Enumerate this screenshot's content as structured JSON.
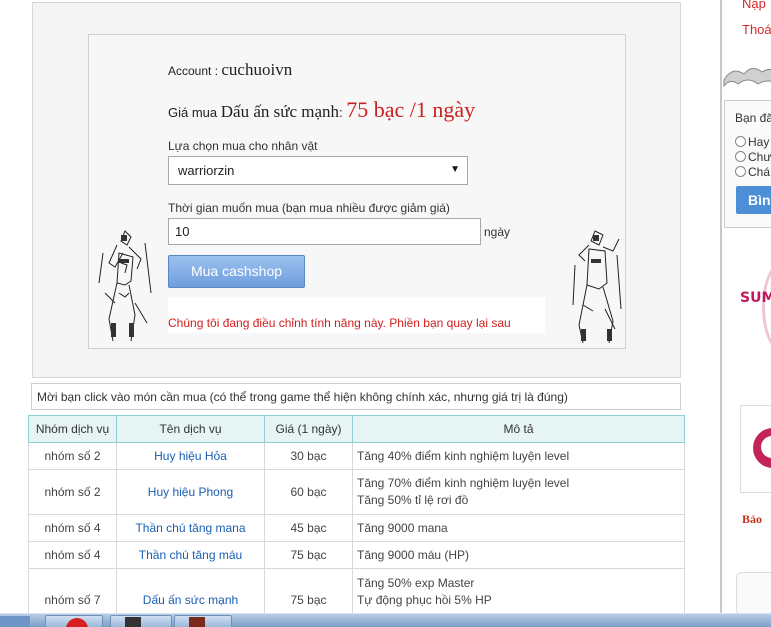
{
  "purchase": {
    "account_label": "Account : ",
    "account_value": "cuchuoivn",
    "price_label": "Giá mua ",
    "item_name": "Dấu ấn sức mạnh",
    "price_colon": ": ",
    "price_text": "75 bạc /1 ngày",
    "character_label": "Lựa chọn mua cho nhân vật",
    "character_selected": "warriorzin",
    "duration_label": "Thời gian muốn mua (bạn mua nhiều được giảm giá)",
    "duration_value": "10",
    "duration_unit": "ngày",
    "buy_button": "Mua cashshop",
    "notice": "Chúng tôi đang điều chỉnh tính năng này. Phiền bạn quay lại sau"
  },
  "hint": "Mời bạn click vào món cần mua (có thể trong game thể hiện không chính xác, nhưng giá trị là đúng)",
  "table": {
    "headers": [
      "Nhóm dịch vụ",
      "Tên dịch vụ",
      "Giá (1 ngày)",
      "Mô tả"
    ],
    "rows": [
      {
        "group": "nhóm số 2",
        "name": "Huy hiệu Hỏa",
        "price": "30 bạc",
        "desc": [
          "Tăng 40% điểm kinh nghiệm luyện level"
        ]
      },
      {
        "group": "nhóm số 2",
        "name": "Huy hiệu Phong",
        "price": "60 bạc",
        "desc": [
          "Tăng 70% điểm kinh nghiệm luyện level",
          "Tăng 50% tỉ lệ rơi đồ"
        ]
      },
      {
        "group": "nhóm số 4",
        "name": "Thần chú tăng mana",
        "price": "45 bạc",
        "desc": [
          "Tăng 9000 mana"
        ]
      },
      {
        "group": "nhóm số 4",
        "name": "Thần chú tăng máu",
        "price": "75 bạc",
        "desc": [
          "Tăng 9000 máu (HP)"
        ]
      },
      {
        "group": "nhóm số 7",
        "name": "Dấu ấn sức mạnh",
        "price": "75 bạc",
        "desc": [
          "Tăng 50% exp Master",
          "Tự động phục hồi 5% HP"
        ]
      }
    ]
  },
  "sidebar": {
    "link_1": "Nạp",
    "link_2": "Thoá",
    "poll_title": "Bạn đã",
    "poll_options": [
      "Hay",
      "Chư",
      "Chá"
    ],
    "vote_button": "Bìn",
    "banner_text": "SUM",
    "bottom_text": "Bảo"
  },
  "colors": {
    "price_red": "#cc1f1f",
    "link_blue": "#1a5fb4",
    "table_header_bg": "#e7f4f4",
    "table_header_border": "#8fd0d6",
    "button_blue": "#6f9ddd"
  }
}
